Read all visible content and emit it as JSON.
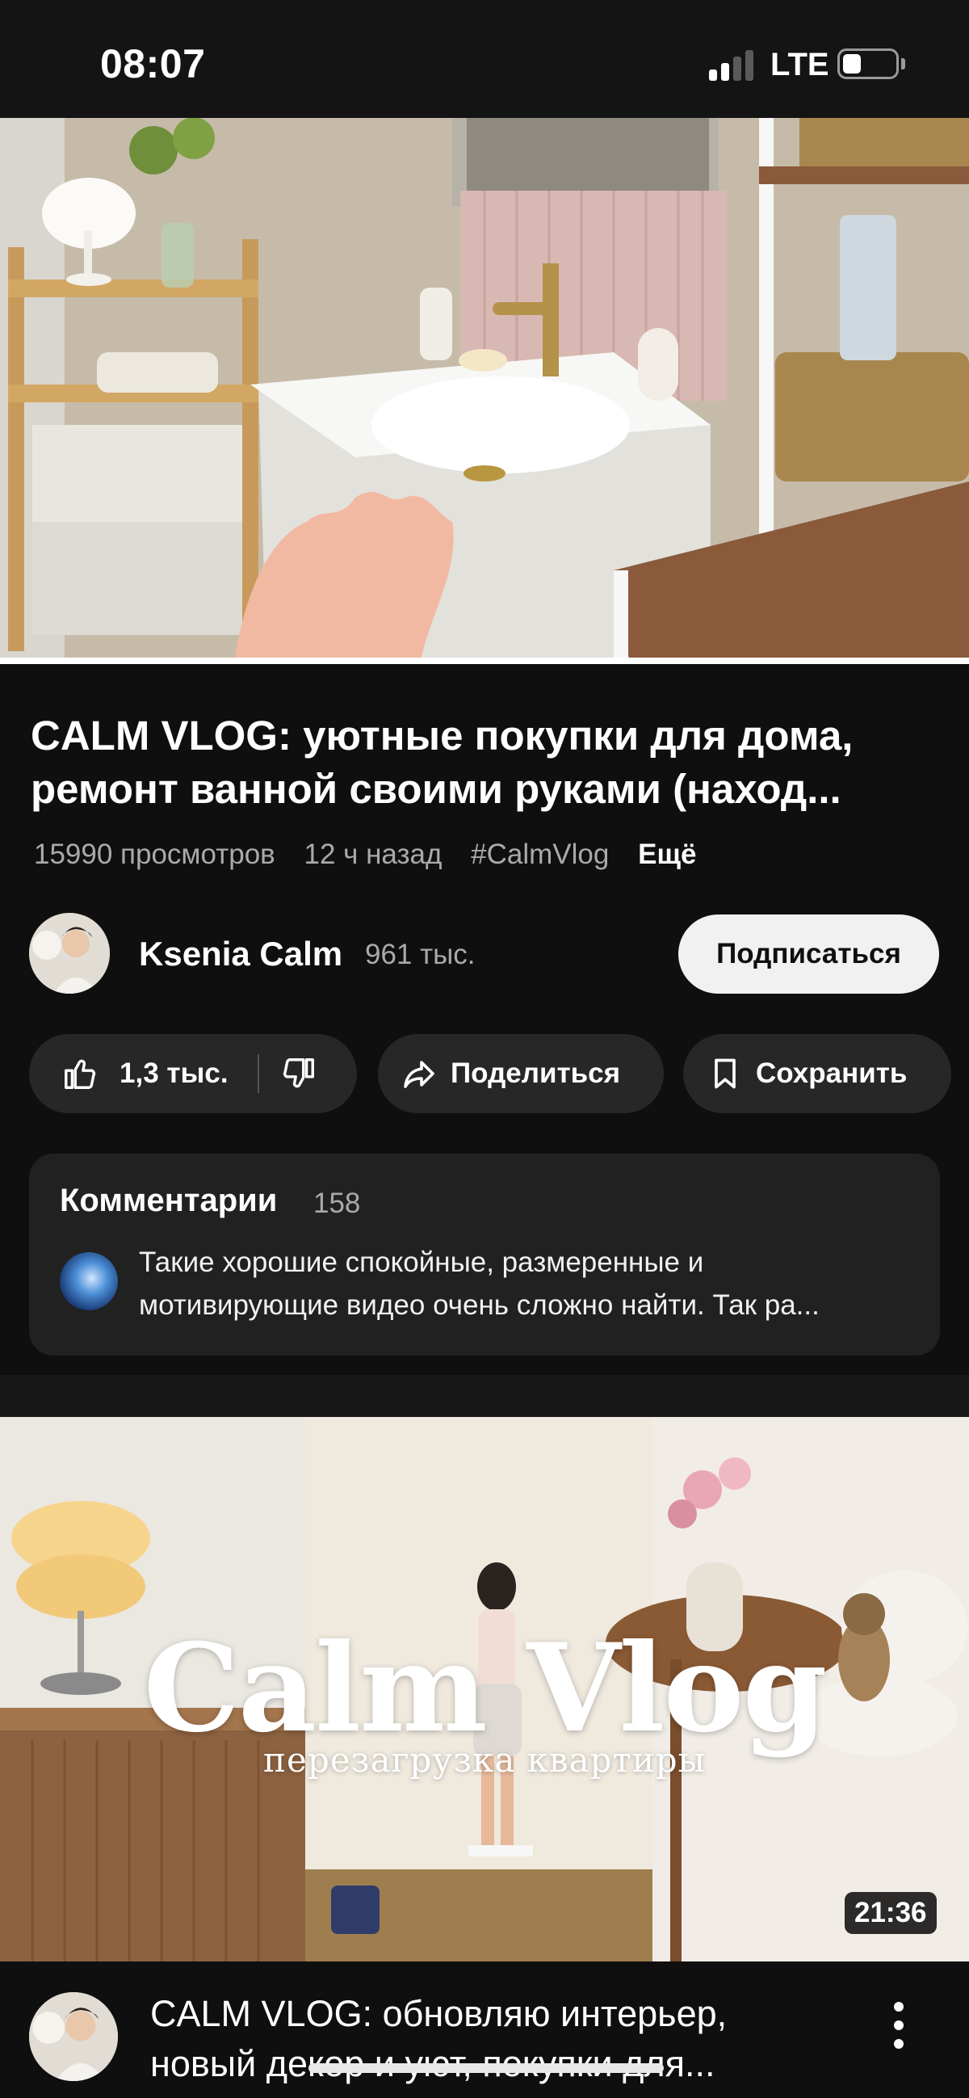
{
  "status_bar": {
    "time": "08:07",
    "network": "LTE",
    "battery_level": 0.25
  },
  "player": {
    "progress_fraction": 1.0
  },
  "video": {
    "title_line1": "CALM VLOG: уютные покупки для дома,",
    "title_line2": "ремонт ванной своими руками (наход...",
    "views": "15990 просмотров",
    "age": "12 ч назад",
    "hashtag": "#CalmVlog",
    "more_label": "Ещё"
  },
  "channel": {
    "name": "Ksenia Calm",
    "subscribers": "961 тыс.",
    "subscribe_label": "Подписаться"
  },
  "actions": {
    "like_count": "1,3 тыс.",
    "share_label": "Поделиться",
    "save_label": "Сохранить"
  },
  "comments": {
    "title": "Комментарии",
    "count": "158",
    "top_comment_line1": "Такие хорошие спокойные, размеренные и",
    "top_comment_line2": "мотивирующие видео очень сложно найти. Так ра..."
  },
  "recommended": {
    "thumbnail_title": "Calm Vlog",
    "thumbnail_subtitle": "перезагрузка квартиры",
    "duration": "21:36",
    "title_line1": "CALM VLOG: обновляю интерьер,",
    "title_line2": "новый декор и уют, покупки для..."
  },
  "icons": {
    "like": "thumbs-up-icon",
    "dislike": "thumbs-down-icon",
    "share": "share-arrow-icon",
    "save": "bookmark-icon",
    "menu": "more-vertical-icon"
  },
  "colors": {
    "background": "#0f0f0f",
    "pill": "#272727",
    "card": "#212121",
    "subscribe_button": "#f1f1f1",
    "secondary_text": "#aaaaaa"
  }
}
